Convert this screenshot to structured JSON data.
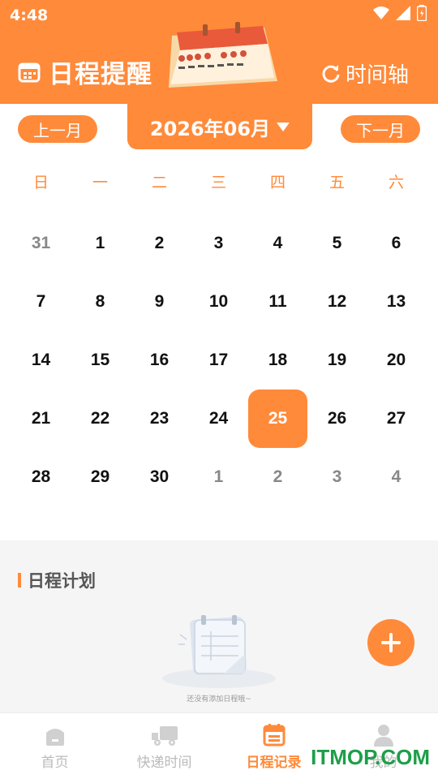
{
  "status": {
    "time": "4:48"
  },
  "header": {
    "title": "日程提醒",
    "timeline_label": "时间轴"
  },
  "month_nav": {
    "prev_label": "上一月",
    "next_label": "下一月",
    "current_month": "2026年06月"
  },
  "weekdays": [
    "日",
    "一",
    "二",
    "三",
    "四",
    "五",
    "六"
  ],
  "weeks": [
    [
      "31",
      "1",
      "2",
      "3",
      "4",
      "5",
      "6"
    ],
    [
      "7",
      "8",
      "9",
      "10",
      "11",
      "12",
      "13"
    ],
    [
      "14",
      "15",
      "16",
      "17",
      "18",
      "19",
      "20"
    ],
    [
      "21",
      "22",
      "23",
      "24",
      "25",
      "26",
      "27"
    ],
    [
      "28",
      "29",
      "30",
      "1",
      "2",
      "3",
      "4"
    ]
  ],
  "selected_day": "25",
  "plan": {
    "title": "日程计划",
    "empty_text": "还没有添加日程哦~"
  },
  "bottom_nav": {
    "items": [
      {
        "label": "首页",
        "icon": "home-icon",
        "active": false
      },
      {
        "label": "快递时间",
        "icon": "truck-icon",
        "active": false
      },
      {
        "label": "日程记录",
        "icon": "calendar-icon",
        "active": true
      },
      {
        "label": "我的",
        "icon": "user-icon",
        "active": false
      }
    ]
  },
  "watermark": "ITMOP.COM",
  "colors": {
    "accent": "#FF8A3A",
    "background": "#FFFFFF",
    "section_bg": "#F5F5F5"
  }
}
